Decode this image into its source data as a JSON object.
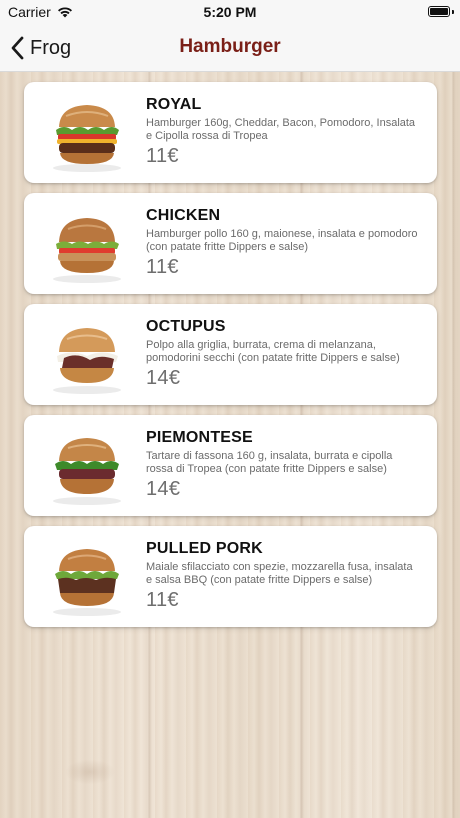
{
  "status_bar": {
    "carrier": "Carrier",
    "time": "5:20 PM"
  },
  "nav": {
    "back_label": "Frog",
    "title": "Hamburger",
    "title_color": "#7a1f17"
  },
  "items": [
    {
      "name": "ROYAL",
      "description": "Hamburger 160g, Cheddar, Bacon, Pomodoro, Insalata e Cipolla rossa di Tropea",
      "price": "11€"
    },
    {
      "name": "CHICKEN",
      "description": "Hamburger pollo 160 g, maionese, insalata e pomodoro (con patate fritte Dippers e salse)",
      "price": "11€"
    },
    {
      "name": "OCTUPUS",
      "description": "Polpo alla griglia, burrata, crema di melanzana, pomodorini secchi  (con patate fritte Dippers e salse)",
      "price": "14€"
    },
    {
      "name": "PIEMONTESE",
      "description": "Tartare di fassona 160 g, insalata, burrata e cipolla rossa di Tropea  (con patate fritte Dippers e salse)",
      "price": "14€"
    },
    {
      "name": "PULLED PORK",
      "description": "Maiale sfilacciato con spezie, mozzarella fusa, insalata e salsa BBQ  (con patate fritte Dippers e salse)",
      "price": "11€"
    }
  ]
}
